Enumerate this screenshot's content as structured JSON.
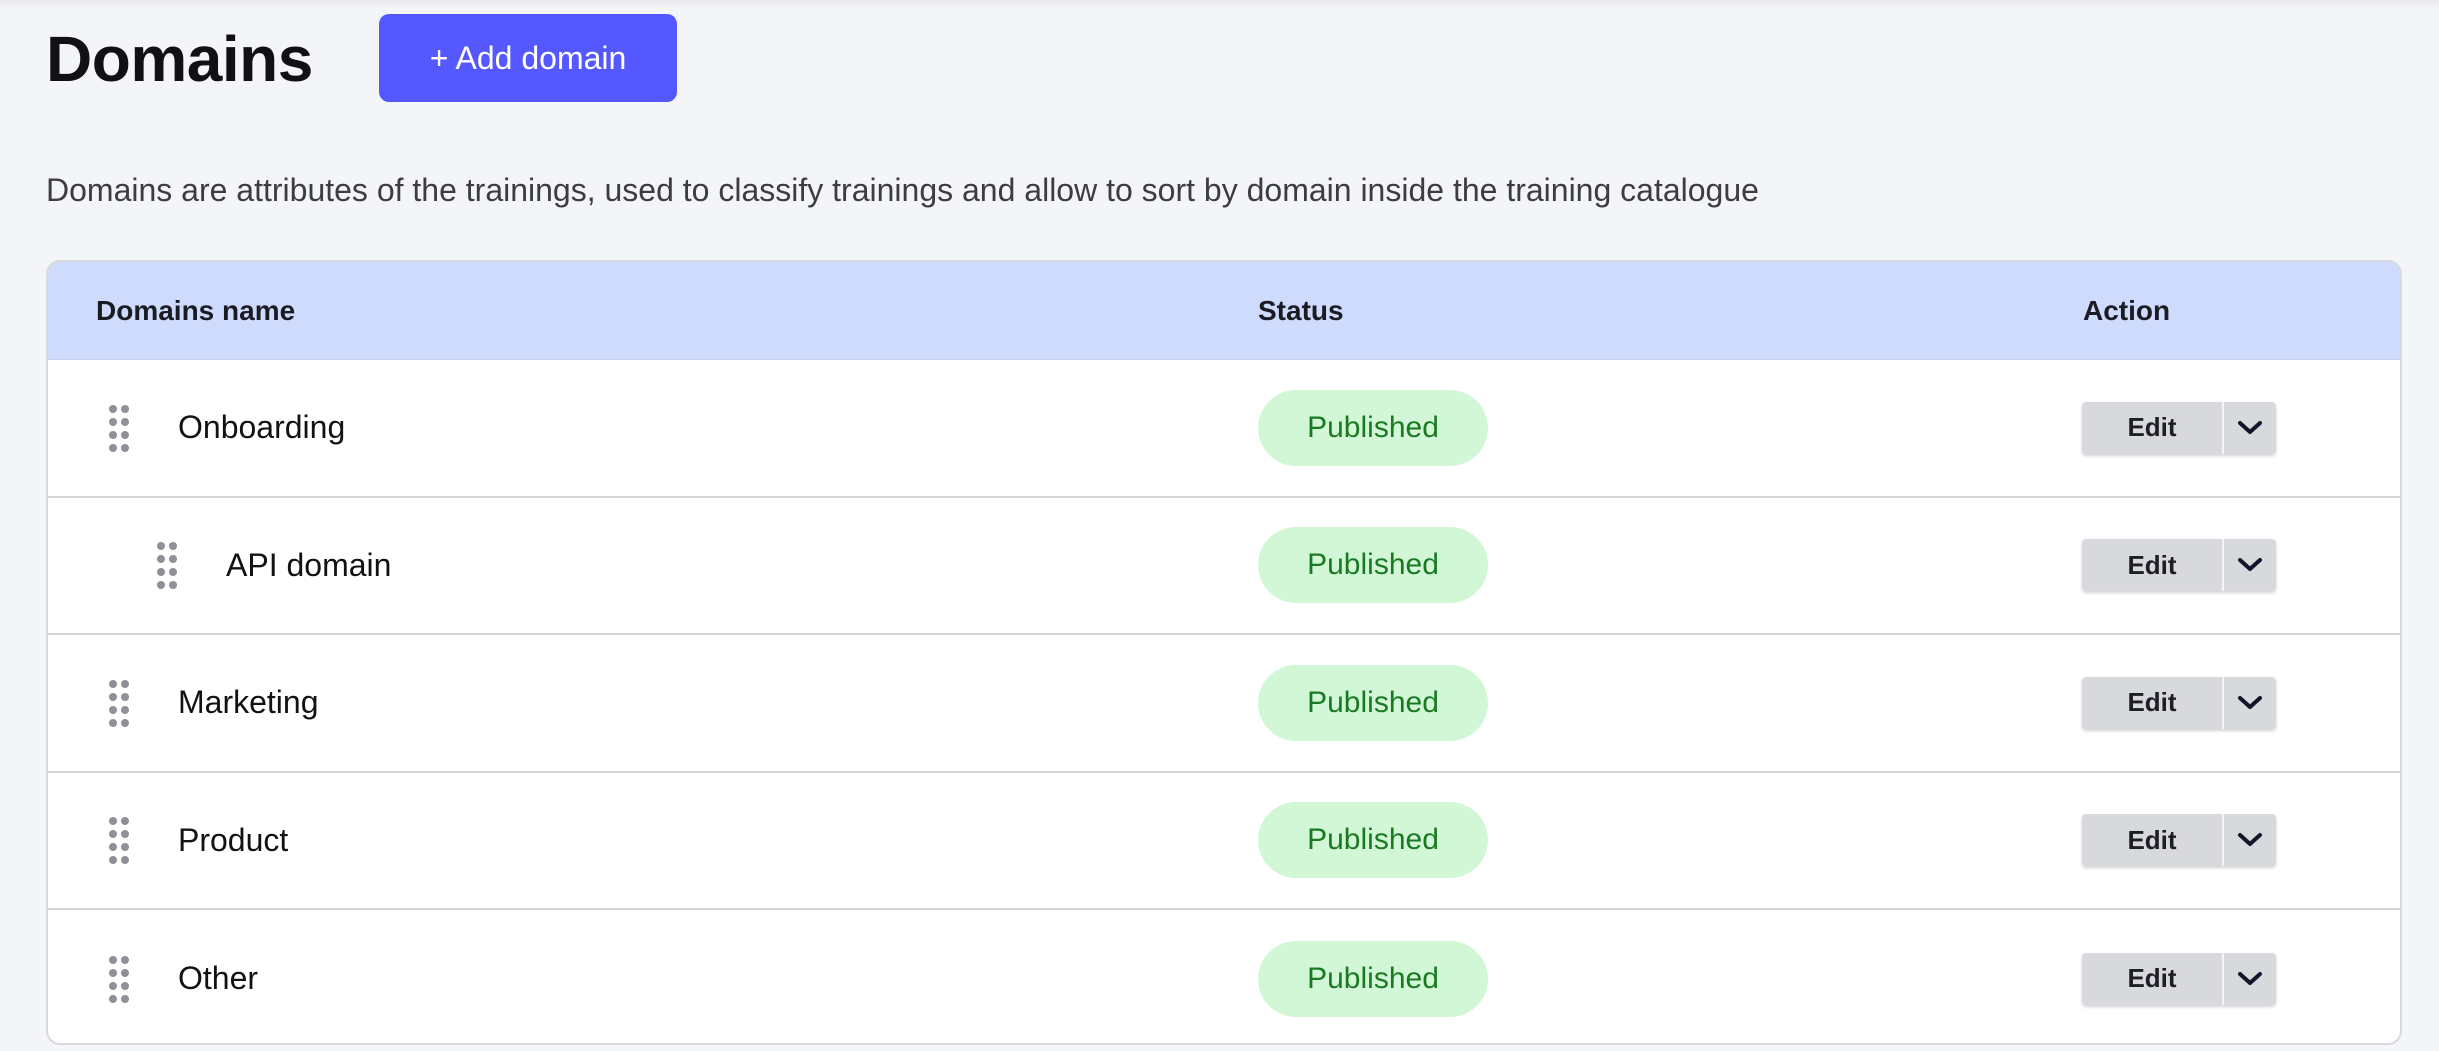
{
  "header": {
    "title": "Domains",
    "add_button_label": "+ Add domain"
  },
  "description": "Domains are attributes of the trainings, used to classify trainings and allow to sort by domain inside the training catalogue",
  "table": {
    "columns": {
      "name": "Domains name",
      "status": "Status",
      "action": "Action"
    },
    "rows": [
      {
        "name": "Onboarding",
        "status": "Published",
        "edit_label": "Edit",
        "depth": 0
      },
      {
        "name": "API domain",
        "status": "Published",
        "edit_label": "Edit",
        "depth": 1
      },
      {
        "name": "Marketing",
        "status": "Published",
        "edit_label": "Edit",
        "depth": 0
      },
      {
        "name": "Product",
        "status": "Published",
        "edit_label": "Edit",
        "depth": 0
      },
      {
        "name": "Other",
        "status": "Published",
        "edit_label": "Edit",
        "depth": 0
      }
    ]
  },
  "colors": {
    "accent": "#5558ff",
    "header_bg": "#cfdbfc",
    "status_bg": "#d1f7d6",
    "status_text": "#1a7a22"
  },
  "icons": {
    "drag_handle": "drag-handle-icon",
    "dropdown": "chevron-down-icon"
  }
}
